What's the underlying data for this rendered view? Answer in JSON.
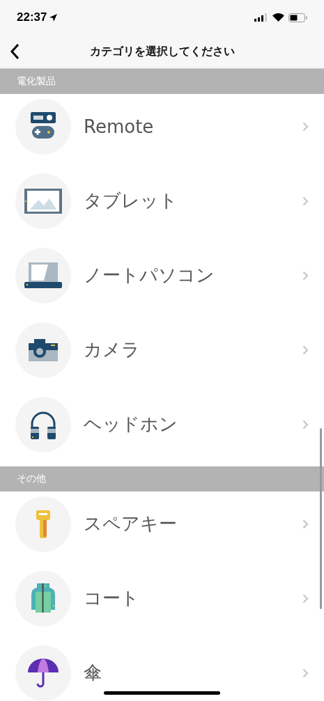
{
  "status_bar": {
    "time": "22:37"
  },
  "nav": {
    "title": "カテゴリを選択してください"
  },
  "sections": [
    {
      "title": "電化製品",
      "items": [
        {
          "label": "Remote"
        },
        {
          "label": "タブレット"
        },
        {
          "label": "ノートパソコン"
        },
        {
          "label": "カメラ"
        },
        {
          "label": "ヘッドホン"
        }
      ]
    },
    {
      "title": "その他",
      "items": [
        {
          "label": "スペアキー"
        },
        {
          "label": "コート"
        },
        {
          "label": "傘"
        }
      ]
    }
  ]
}
